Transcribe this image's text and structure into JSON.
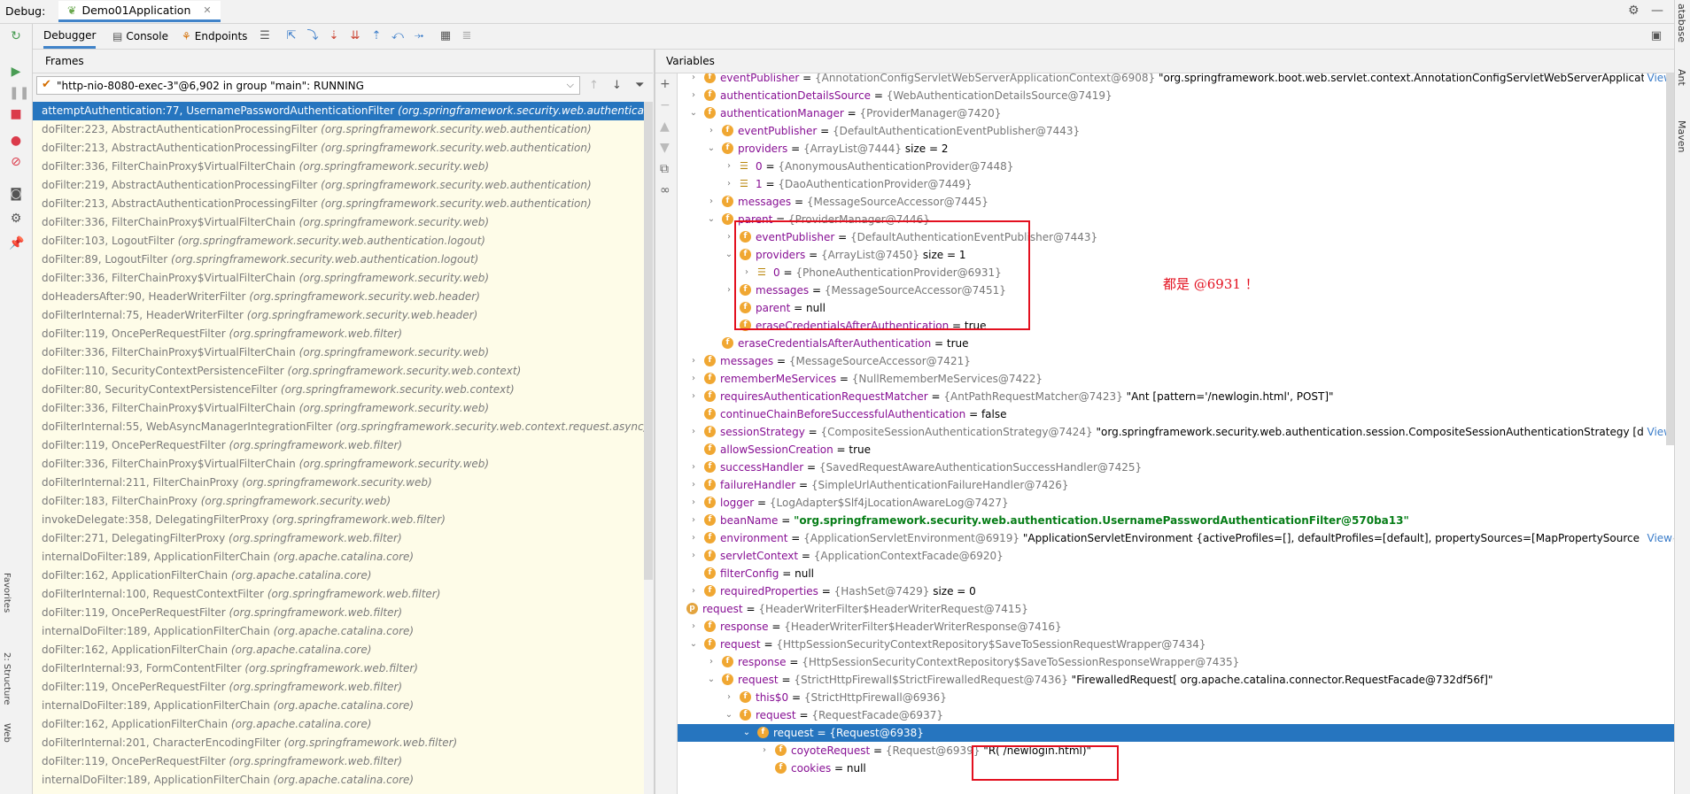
{
  "window": {
    "debug_label": "Debug:",
    "run_tab": "Demo01Application"
  },
  "right_strip": [
    "atabase",
    "Ant",
    "Maven"
  ],
  "left_strip_text": [
    "Favorites",
    "2: Structure",
    "Web"
  ],
  "toolbar": {
    "tabs": [
      "Debugger",
      "Console",
      "Endpoints"
    ]
  },
  "frames": {
    "header": "Frames",
    "thread": "\"http-nio-8080-exec-3\"@6,902 in group \"main\": RUNNING",
    "items": [
      {
        "m": "attemptAuthentication:77, UsernamePasswordAuthenticationFilter",
        "p": "(org.springframework.security.web.authentication)"
      },
      {
        "m": "doFilter:223, AbstractAuthenticationProcessingFilter",
        "p": "(org.springframework.security.web.authentication)"
      },
      {
        "m": "doFilter:213, AbstractAuthenticationProcessingFilter",
        "p": "(org.springframework.security.web.authentication)"
      },
      {
        "m": "doFilter:336, FilterChainProxy$VirtualFilterChain",
        "p": "(org.springframework.security.web)"
      },
      {
        "m": "doFilter:219, AbstractAuthenticationProcessingFilter",
        "p": "(org.springframework.security.web.authentication)"
      },
      {
        "m": "doFilter:213, AbstractAuthenticationProcessingFilter",
        "p": "(org.springframework.security.web.authentication)"
      },
      {
        "m": "doFilter:336, FilterChainProxy$VirtualFilterChain",
        "p": "(org.springframework.security.web)"
      },
      {
        "m": "doFilter:103, LogoutFilter",
        "p": "(org.springframework.security.web.authentication.logout)"
      },
      {
        "m": "doFilter:89, LogoutFilter",
        "p": "(org.springframework.security.web.authentication.logout)"
      },
      {
        "m": "doFilter:336, FilterChainProxy$VirtualFilterChain",
        "p": "(org.springframework.security.web)"
      },
      {
        "m": "doHeadersAfter:90, HeaderWriterFilter",
        "p": "(org.springframework.security.web.header)"
      },
      {
        "m": "doFilterInternal:75, HeaderWriterFilter",
        "p": "(org.springframework.security.web.header)"
      },
      {
        "m": "doFilter:119, OncePerRequestFilter",
        "p": "(org.springframework.web.filter)"
      },
      {
        "m": "doFilter:336, FilterChainProxy$VirtualFilterChain",
        "p": "(org.springframework.security.web)"
      },
      {
        "m": "doFilter:110, SecurityContextPersistenceFilter",
        "p": "(org.springframework.security.web.context)"
      },
      {
        "m": "doFilter:80, SecurityContextPersistenceFilter",
        "p": "(org.springframework.security.web.context)"
      },
      {
        "m": "doFilter:336, FilterChainProxy$VirtualFilterChain",
        "p": "(org.springframework.security.web)"
      },
      {
        "m": "doFilterInternal:55, WebAsyncManagerIntegrationFilter",
        "p": "(org.springframework.security.web.context.request.async)"
      },
      {
        "m": "doFilter:119, OncePerRequestFilter",
        "p": "(org.springframework.web.filter)"
      },
      {
        "m": "doFilter:336, FilterChainProxy$VirtualFilterChain",
        "p": "(org.springframework.security.web)"
      },
      {
        "m": "doFilterInternal:211, FilterChainProxy",
        "p": "(org.springframework.security.web)"
      },
      {
        "m": "doFilter:183, FilterChainProxy",
        "p": "(org.springframework.security.web)"
      },
      {
        "m": "invokeDelegate:358, DelegatingFilterProxy",
        "p": "(org.springframework.web.filter)"
      },
      {
        "m": "doFilter:271, DelegatingFilterProxy",
        "p": "(org.springframework.web.filter)"
      },
      {
        "m": "internalDoFilter:189, ApplicationFilterChain",
        "p": "(org.apache.catalina.core)"
      },
      {
        "m": "doFilter:162, ApplicationFilterChain",
        "p": "(org.apache.catalina.core)"
      },
      {
        "m": "doFilterInternal:100, RequestContextFilter",
        "p": "(org.springframework.web.filter)"
      },
      {
        "m": "doFilter:119, OncePerRequestFilter",
        "p": "(org.springframework.web.filter)"
      },
      {
        "m": "internalDoFilter:189, ApplicationFilterChain",
        "p": "(org.apache.catalina.core)"
      },
      {
        "m": "doFilter:162, ApplicationFilterChain",
        "p": "(org.apache.catalina.core)"
      },
      {
        "m": "doFilterInternal:93, FormContentFilter",
        "p": "(org.springframework.web.filter)"
      },
      {
        "m": "doFilter:119, OncePerRequestFilter",
        "p": "(org.springframework.web.filter)"
      },
      {
        "m": "internalDoFilter:189, ApplicationFilterChain",
        "p": "(org.apache.catalina.core)"
      },
      {
        "m": "doFilter:162, ApplicationFilterChain",
        "p": "(org.apache.catalina.core)"
      },
      {
        "m": "doFilterInternal:201, CharacterEncodingFilter",
        "p": "(org.springframework.web.filter)"
      },
      {
        "m": "doFilter:119, OncePerRequestFilter",
        "p": "(org.springframework.web.filter)"
      },
      {
        "m": "internalDoFilter:189, ApplicationFilterChain",
        "p": "(org.apache.catalina.core)"
      }
    ]
  },
  "variables": {
    "header": "Variables",
    "view_label": "View",
    "annotation": "都是 @6931 ！",
    "rows": [
      {
        "d": 0,
        "a": "r",
        "i": "f",
        "n": "eventPublisher",
        "t": "{AnnotationConfigServletWebServerApplicationContext@6908}",
        "v": "\"org.springframework.boot.web.servlet.context.AnnotationConfigServletWebServerApplicationC...",
        "view": true
      },
      {
        "d": 0,
        "a": "r",
        "i": "f",
        "n": "authenticationDetailsSource",
        "t": "{WebAuthenticationDetailsSource@7419}"
      },
      {
        "d": 0,
        "a": "d",
        "i": "f",
        "n": "authenticationManager",
        "t": "{ProviderManager@7420}"
      },
      {
        "d": 1,
        "a": "r",
        "i": "f",
        "n": "eventPublisher",
        "t": "{DefaultAuthenticationEventPublisher@7443}"
      },
      {
        "d": 1,
        "a": "d",
        "i": "f",
        "n": "providers",
        "t": "{ArrayList@7444}",
        "v": " size = 2"
      },
      {
        "d": 2,
        "a": "r",
        "i": "l",
        "n": "0",
        "t": "{AnonymousAuthenticationProvider@7448}"
      },
      {
        "d": 2,
        "a": "r",
        "i": "l",
        "n": "1",
        "t": "{DaoAuthenticationProvider@7449}"
      },
      {
        "d": 1,
        "a": "r",
        "i": "f",
        "n": "messages",
        "t": "{MessageSourceAccessor@7445}"
      },
      {
        "d": 1,
        "a": "d",
        "i": "f",
        "n": "parent",
        "t": "{ProviderManager@7446}"
      },
      {
        "d": 2,
        "a": "r",
        "i": "f",
        "n": "eventPublisher",
        "t": "{DefaultAuthenticationEventPublisher@7443}"
      },
      {
        "d": 2,
        "a": "d",
        "i": "f",
        "n": "providers",
        "t": "{ArrayList@7450}",
        "v": " size = 1"
      },
      {
        "d": 3,
        "a": "r",
        "i": "l",
        "n": "0",
        "t": "{PhoneAuthenticationProvider@6931}"
      },
      {
        "d": 2,
        "a": "r",
        "i": "f",
        "n": "messages",
        "t": "{MessageSourceAccessor@7451}"
      },
      {
        "d": 2,
        "a": "",
        "i": "f",
        "n": "parent",
        "v": "null"
      },
      {
        "d": 2,
        "a": "",
        "i": "f",
        "n": "eraseCredentialsAfterAuthentication",
        "v": "true"
      },
      {
        "d": 1,
        "a": "",
        "i": "f",
        "n": "eraseCredentialsAfterAuthentication",
        "v": "true"
      },
      {
        "d": 0,
        "a": "r",
        "i": "f",
        "n": "messages",
        "t": "{MessageSourceAccessor@7421}"
      },
      {
        "d": 0,
        "a": "r",
        "i": "f",
        "n": "rememberMeServices",
        "t": "{NullRememberMeServices@7422}"
      },
      {
        "d": 0,
        "a": "r",
        "i": "f",
        "n": "requiresAuthenticationRequestMatcher",
        "t": "{AntPathRequestMatcher@7423}",
        "v": "\"Ant [pattern='/newlogin.html', POST]\""
      },
      {
        "d": 0,
        "a": "",
        "i": "f",
        "n": "continueChainBeforeSuccessfulAuthentication",
        "v": "false"
      },
      {
        "d": 0,
        "a": "r",
        "i": "f",
        "n": "sessionStrategy",
        "t": "{CompositeSessionAuthenticationStrategy@7424}",
        "v": "\"org.springframework.security.web.authentication.session.CompositeSessionAuthenticationStrategy [delega...",
        "view": true
      },
      {
        "d": 0,
        "a": "",
        "i": "f",
        "n": "allowSessionCreation",
        "v": "true"
      },
      {
        "d": 0,
        "a": "r",
        "i": "f",
        "n": "successHandler",
        "t": "{SavedRequestAwareAuthenticationSuccessHandler@7425}"
      },
      {
        "d": 0,
        "a": "r",
        "i": "f",
        "n": "failureHandler",
        "t": "{SimpleUrlAuthenticationFailureHandler@7426}"
      },
      {
        "d": 0,
        "a": "r",
        "i": "fs",
        "n": "logger",
        "t": "{LogAdapter$Slf4jLocationAwareLog@7427}"
      },
      {
        "d": 0,
        "a": "r",
        "i": "f",
        "n": "beanName",
        "s": "\"org.springframework.security.web.authentication.UsernamePasswordAuthenticationFilter@570ba13\""
      },
      {
        "d": 0,
        "a": "r",
        "i": "f",
        "n": "environment",
        "t": "{ApplicationServletEnvironment@6919}",
        "v": "\"ApplicationServletEnvironment {activeProfiles=[], defaultProfiles=[default], propertySources=[MapPropertySource {name...",
        "view": true
      },
      {
        "d": 0,
        "a": "r",
        "i": "f",
        "n": "servletContext",
        "t": "{ApplicationContextFacade@6920}"
      },
      {
        "d": 0,
        "a": "",
        "i": "f",
        "n": "filterConfig",
        "v": "null"
      },
      {
        "d": 0,
        "a": "r",
        "i": "fs",
        "n": "requiredProperties",
        "t": "{HashSet@7429}",
        "v": " size = 0"
      },
      {
        "d": -1,
        "a": "d",
        "i": "p",
        "n": "request",
        "t": "{HeaderWriterFilter$HeaderWriterRequest@7415}"
      },
      {
        "d": 0,
        "a": "r",
        "i": "fs",
        "n": "response",
        "t": "{HeaderWriterFilter$HeaderWriterResponse@7416}"
      },
      {
        "d": 0,
        "a": "d",
        "i": "f",
        "n": "request",
        "t": "{HttpSessionSecurityContextRepository$SaveToSessionRequestWrapper@7434}"
      },
      {
        "d": 1,
        "a": "r",
        "i": "fs",
        "n": "response",
        "t": "{HttpSessionSecurityContextRepository$SaveToSessionResponseWrapper@7435}"
      },
      {
        "d": 1,
        "a": "d",
        "i": "f",
        "n": "request",
        "t": "{StrictHttpFirewall$StrictFirewalledRequest@7436}",
        "v": "\"FirewalledRequest[ org.apache.catalina.connector.RequestFacade@732df56f]\""
      },
      {
        "d": 2,
        "a": "r",
        "i": "f",
        "n": "this$0",
        "t": "{StrictHttpFirewall@6936}"
      },
      {
        "d": 2,
        "a": "d",
        "i": "f",
        "n": "request",
        "t": "{RequestFacade@6937}"
      },
      {
        "d": 3,
        "a": "d",
        "i": "f",
        "n": "request",
        "t": "{Request@6938}",
        "sel": true
      },
      {
        "d": 4,
        "a": "r",
        "i": "f",
        "n": "coyoteRequest",
        "t": "{Request@6939}",
        "v": "\"R( /newlogin.html)\""
      },
      {
        "d": 4,
        "a": "",
        "i": "f",
        "n": "cookies",
        "v": "null"
      }
    ]
  }
}
